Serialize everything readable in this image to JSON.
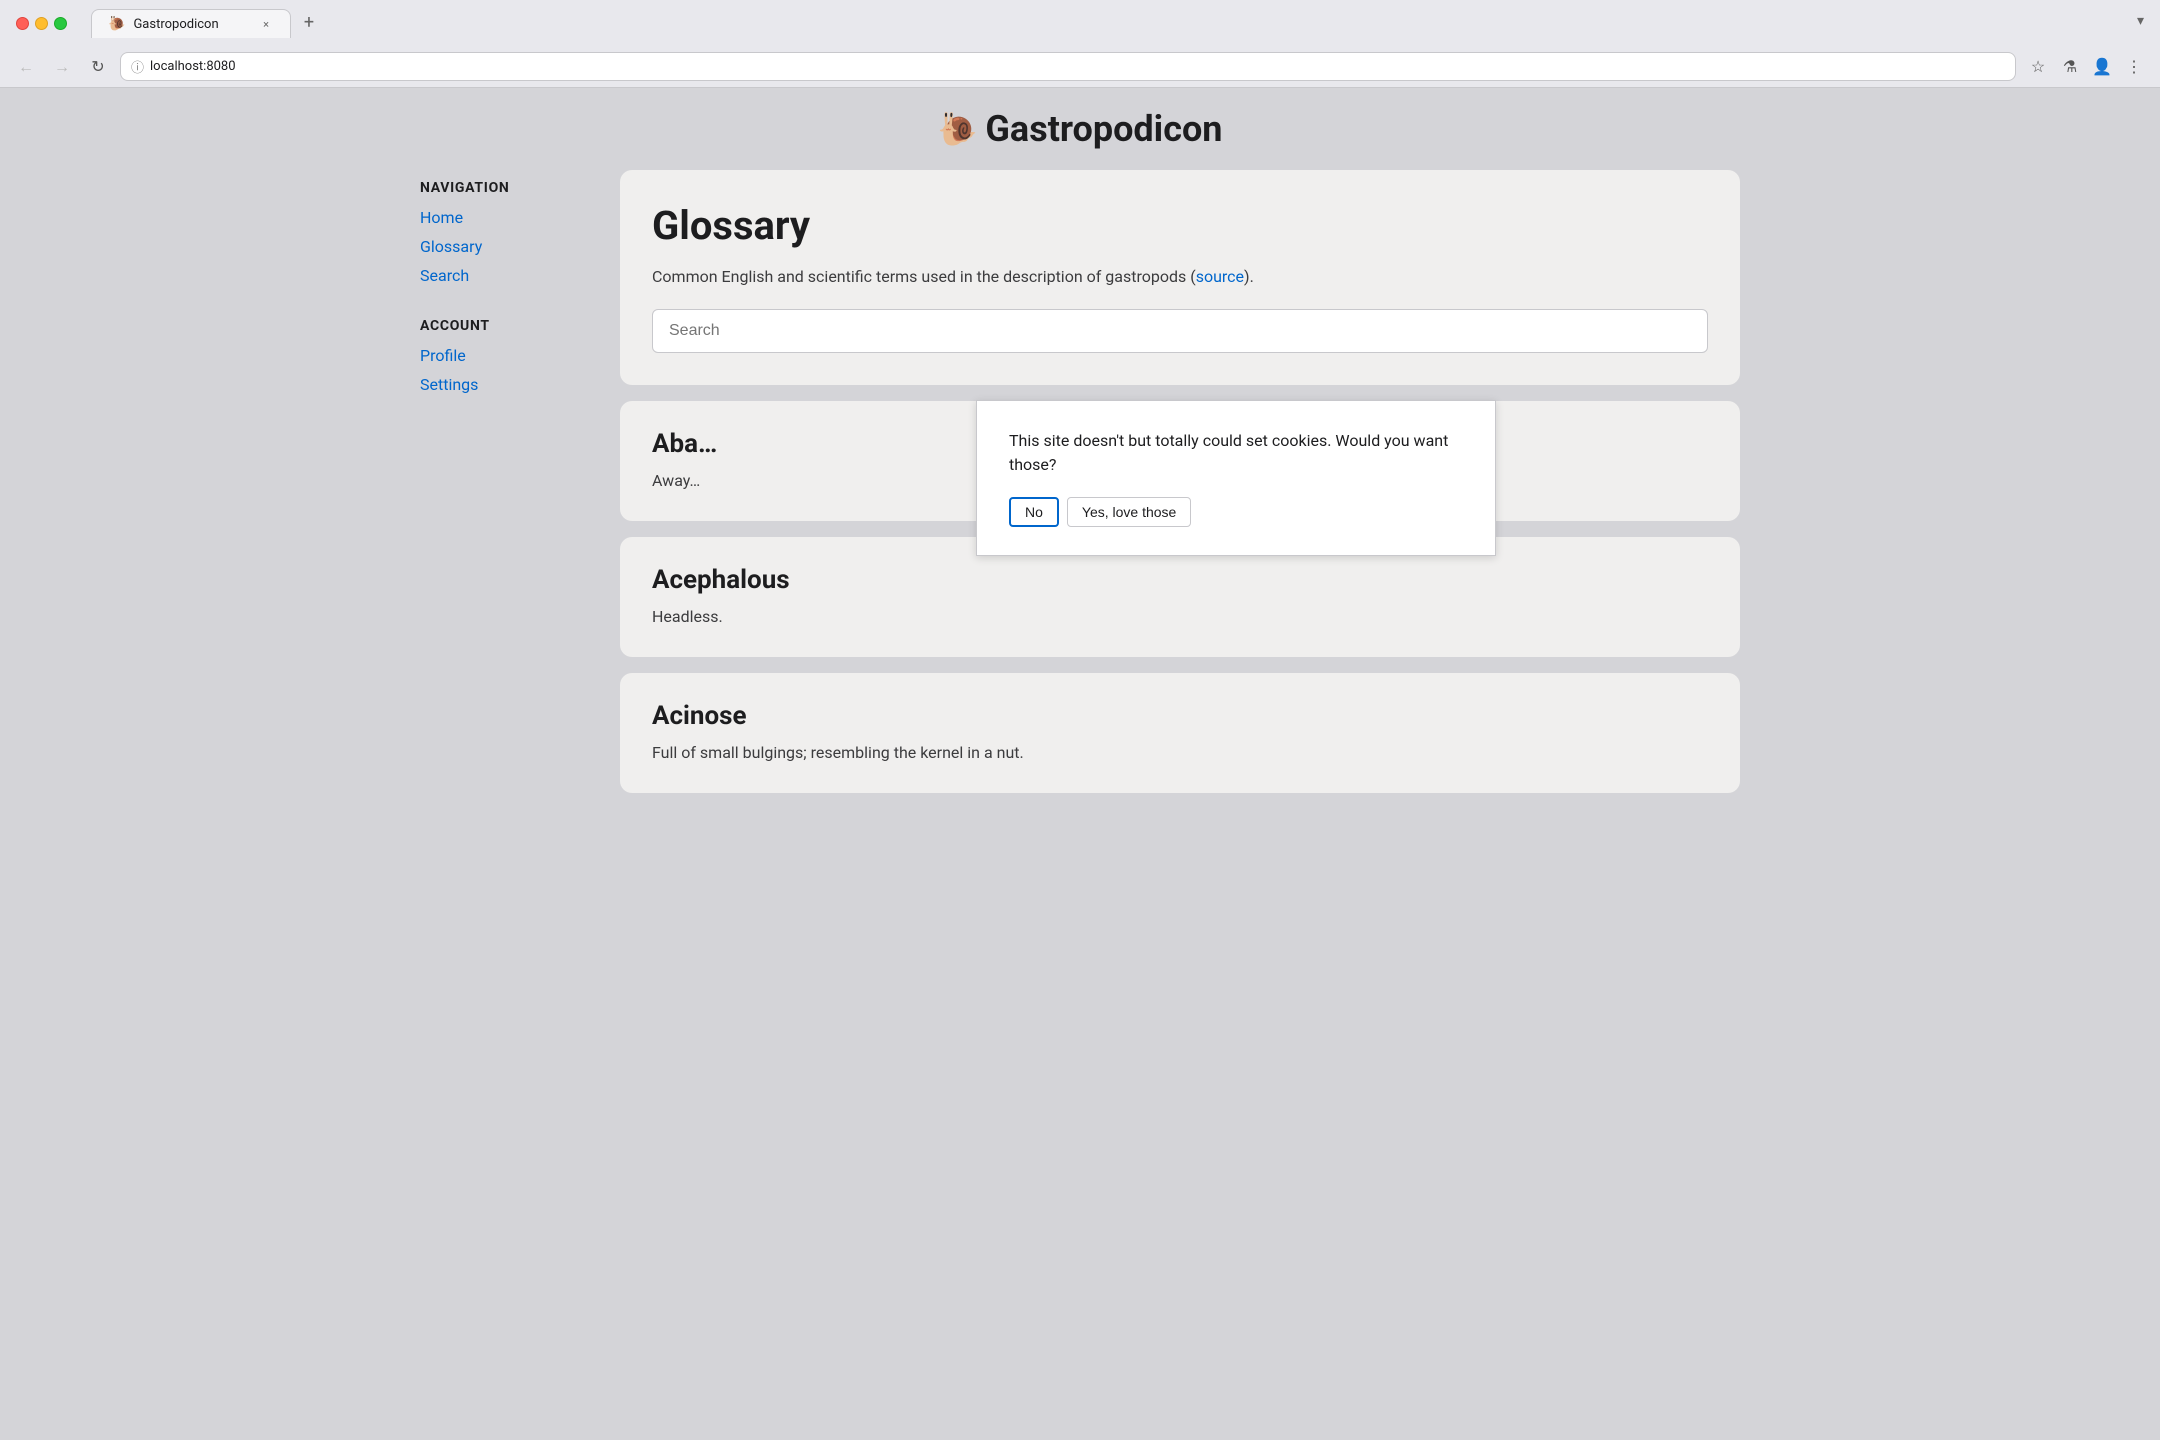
{
  "browser": {
    "traffic_lights": {
      "close": "close",
      "minimize": "minimize",
      "maximize": "maximize"
    },
    "tab": {
      "favicon": "🐌",
      "title": "Gastropodicon",
      "close_label": "×"
    },
    "tab_add_label": "+",
    "tab_dropdown_label": "▾",
    "nav": {
      "back_label": "←",
      "forward_label": "→",
      "reload_label": "↻"
    },
    "address": {
      "url": "localhost:8080",
      "icon": "ⓘ"
    },
    "toolbar_actions": {
      "bookmark": "☆",
      "flask": "⚗",
      "profile": "👤",
      "menu": "⋮"
    }
  },
  "site": {
    "logo": "🐌",
    "title": "Gastropodicon"
  },
  "sidebar": {
    "nav_label": "NAVIGATION",
    "nav_links": [
      {
        "label": "Home",
        "href": "#"
      },
      {
        "label": "Glossary",
        "href": "#"
      },
      {
        "label": "Search",
        "href": "#"
      }
    ],
    "account_label": "ACCOUNT",
    "account_links": [
      {
        "label": "Profile",
        "href": "#"
      },
      {
        "label": "Settings",
        "href": "#"
      }
    ]
  },
  "glossary": {
    "title": "Glossary",
    "description_before": "Common English and scientific terms used in the description of gastropods (",
    "description_link_text": "source",
    "description_link_href": "#",
    "description_after": ").",
    "search_placeholder": "Search"
  },
  "terms": [
    {
      "title": "Aba…",
      "definition": "Away…",
      "truncated": true
    },
    {
      "title": "Acephalous",
      "definition": "Headless.",
      "truncated": false
    },
    {
      "title": "Acinose",
      "definition": "Full of small bulgings; resembling the kernel in a nut.",
      "truncated": false
    }
  ],
  "cookie_dialog": {
    "message": "This site doesn't but totally could set cookies. Would you want those?",
    "btn_no": "No",
    "btn_yes": "Yes, love those"
  }
}
